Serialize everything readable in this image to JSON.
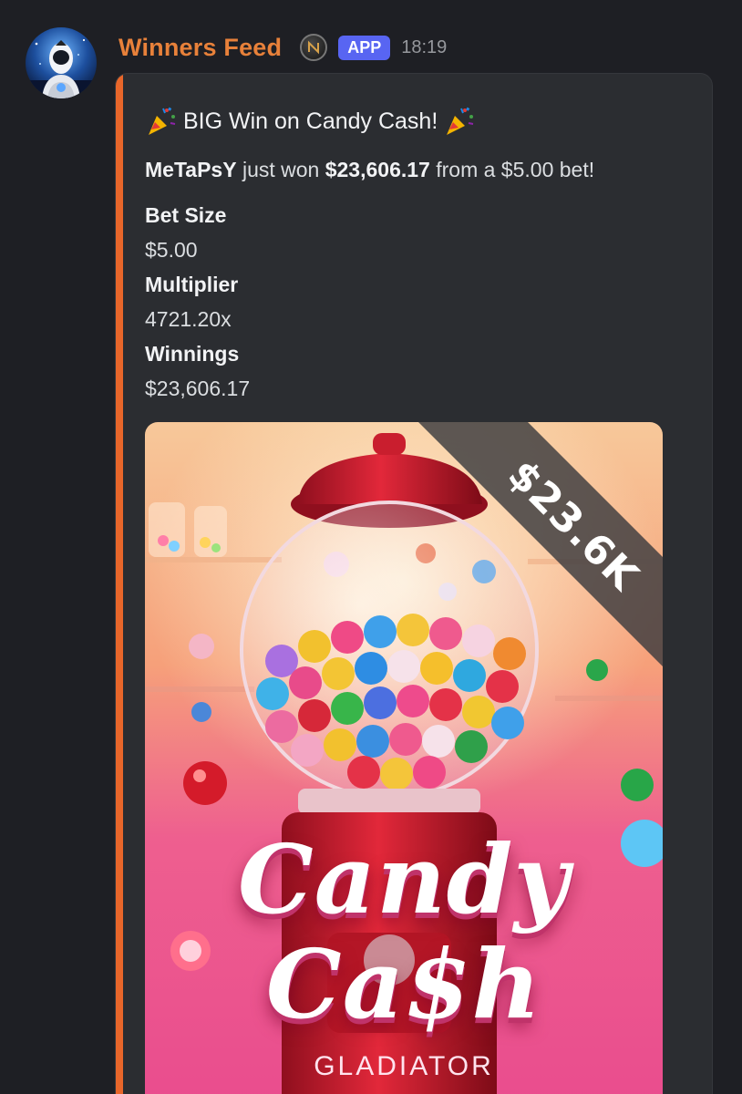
{
  "message": {
    "author": "Winners Feed",
    "badge": "APP",
    "timestamp": "18:19",
    "author_color": "#e8813a",
    "badge_color": "#5865f2"
  },
  "embed": {
    "accent_color": "#e8662a",
    "title": "BIG Win on Candy Cash!",
    "title_icon": "party-popper-icon",
    "description": {
      "player": "MeTaPsY",
      "text_1": " just won ",
      "amount": "$23,606.17",
      "text_2": " from a $5.00 bet!"
    },
    "fields": [
      {
        "name": "Bet Size",
        "value": "$5.00"
      },
      {
        "name": "Multiplier",
        "value": "4721.20x"
      },
      {
        "name": "Winnings",
        "value": "$23,606.17"
      }
    ],
    "image": {
      "logo_line_1": "Candy",
      "logo_line_2": "Ca$h",
      "studio": "GLADIATOR",
      "win_ribbon": "$23.6K"
    }
  }
}
